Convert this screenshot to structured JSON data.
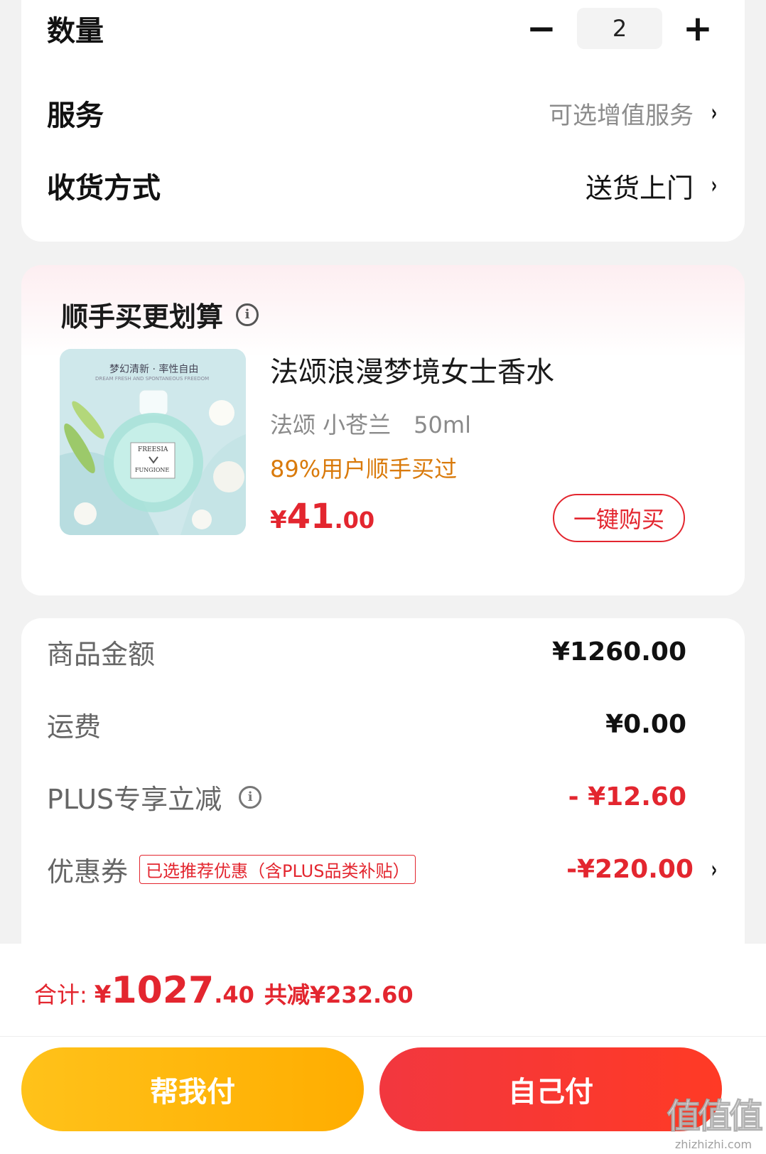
{
  "order": {
    "quantity_label": "数量",
    "quantity_value": "2",
    "decrement": "−",
    "increment": "+",
    "service_label": "服务",
    "service_value": "可选增值服务",
    "delivery_label": "收货方式",
    "delivery_value": "送货上门",
    "chevron": "›"
  },
  "addon": {
    "title": "顺手买更划算",
    "info_glyph": "i",
    "image_text": "梦幻清新 · 率性自由",
    "image_subtext": "DREAM FRESH AND SPONTANEOUS FREEDOM",
    "bottle_label": "FREESIA",
    "bottle_sub": "FUNGIONE",
    "product_name": "法颂浪漫梦境女士香水",
    "product_spec": "法颂 小苍兰　50ml",
    "product_stat": "89%用户顺手买过",
    "price_currency": "¥",
    "price_int": "41",
    "price_dec": ".00",
    "buy_label": "一键购买"
  },
  "price": {
    "goods_label": "商品金额",
    "goods_value": "¥1260.00",
    "shipping_label": "运费",
    "shipping_value": "¥0.00",
    "plus_label": "PLUS专享立减",
    "plus_value": "- ¥12.60",
    "coupon_label": "优惠券",
    "coupon_badge": "已选推荐优惠（含PLUS品类补贴）",
    "coupon_value": "-¥220.00"
  },
  "bottom": {
    "total_label": "合计:",
    "total_currency": "¥",
    "total_int": "1027",
    "total_dec": ".40",
    "saved": "共减¥232.60",
    "help_pay": "帮我付",
    "self_pay": "自己付"
  },
  "watermark": {
    "logo": "值值值",
    "url": "zhizhizhi.com"
  },
  "colors": {
    "accent_red": "#e3262f",
    "accent_orange": "#d97a0b",
    "help_pay_yellow": "#ffb300",
    "self_pay_red": "#f2373f"
  }
}
